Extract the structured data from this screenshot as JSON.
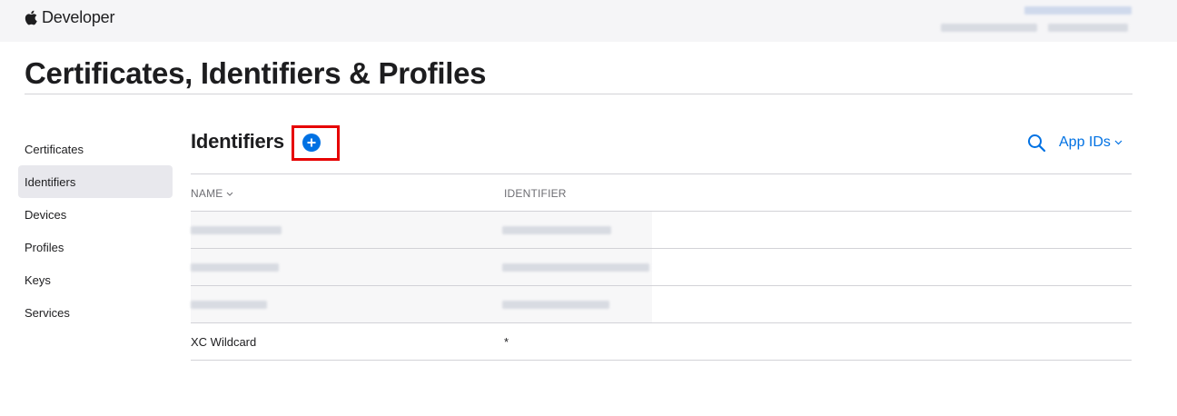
{
  "header": {
    "brand_label": "Developer"
  },
  "page": {
    "title": "Certificates, Identifiers & Profiles"
  },
  "sidebar": {
    "items": [
      {
        "label": "Certificates"
      },
      {
        "label": "Identifiers",
        "active": true
      },
      {
        "label": "Devices"
      },
      {
        "label": "Profiles"
      },
      {
        "label": "Keys"
      },
      {
        "label": "Services"
      }
    ]
  },
  "section": {
    "title": "Identifiers",
    "filter_label": "App IDs",
    "icons": {
      "add": "plus-circle-icon",
      "search": "search-icon",
      "filter_chevron": "chevron-down-icon"
    }
  },
  "table": {
    "columns": [
      "NAME",
      "IDENTIFIER"
    ],
    "rows": [
      {
        "name": "",
        "identifier": "",
        "redacted": true
      },
      {
        "name": "",
        "identifier": "",
        "redacted": true
      },
      {
        "name": "",
        "identifier": "",
        "redacted": true
      },
      {
        "name": "XC Wildcard",
        "identifier": "*"
      }
    ]
  },
  "colors": {
    "accent": "#0071e3",
    "highlight": "#e60000",
    "topbar": "#f5f5f7",
    "divider": "#d2d2d7"
  }
}
